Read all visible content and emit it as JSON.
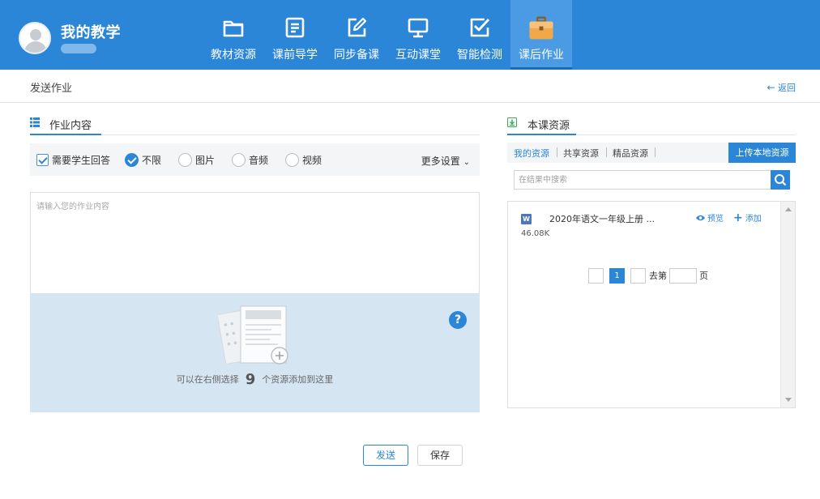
{
  "header": {
    "title": "我的教学",
    "nav": [
      {
        "label": "教材资源",
        "icon": "folder-icon"
      },
      {
        "label": "课前导学",
        "icon": "document-icon"
      },
      {
        "label": "同步备课",
        "icon": "edit-icon"
      },
      {
        "label": "互动课堂",
        "icon": "monitor-icon"
      },
      {
        "label": "智能检测",
        "icon": "checkbox-icon"
      },
      {
        "label": "课后作业",
        "icon": "briefcase-icon",
        "active": true
      }
    ],
    "colors": {
      "bar": "#2b86d8",
      "active_tab": "#4a9be4"
    }
  },
  "breadcrumb": {
    "current": "发送作业",
    "back_label": "返回"
  },
  "homework": {
    "section_title": "作业内容",
    "require_answer_label": "需要学生回答",
    "answer_types": [
      {
        "label": "不限",
        "selected": true
      },
      {
        "label": "图片",
        "selected": false
      },
      {
        "label": "音频",
        "selected": false
      },
      {
        "label": "视频",
        "selected": false
      }
    ],
    "more_settings_label": "更多设置",
    "editor_placeholder": "请输入您的作业内容",
    "dropzone": {
      "text_before": "可以在右侧选择",
      "count": "9",
      "text_after": "个资源添加到这里"
    },
    "help_label": "?",
    "send_label": "发送",
    "save_label": "保存"
  },
  "resources": {
    "section_title": "本课资源",
    "tabs": [
      "我的资源",
      "共享资源",
      "精品资源"
    ],
    "active_tab": 0,
    "upload_label": "上传本地资源",
    "search_placeholder": "在结果中搜索",
    "items": [
      {
        "type_icon": "W",
        "name": "2020年语文一年级上册 ...",
        "size": "46.08K",
        "preview_label": "预览",
        "add_label": "添加"
      }
    ],
    "pager": {
      "current_page": "1",
      "goto_label": "去第",
      "page_unit": "页"
    }
  }
}
